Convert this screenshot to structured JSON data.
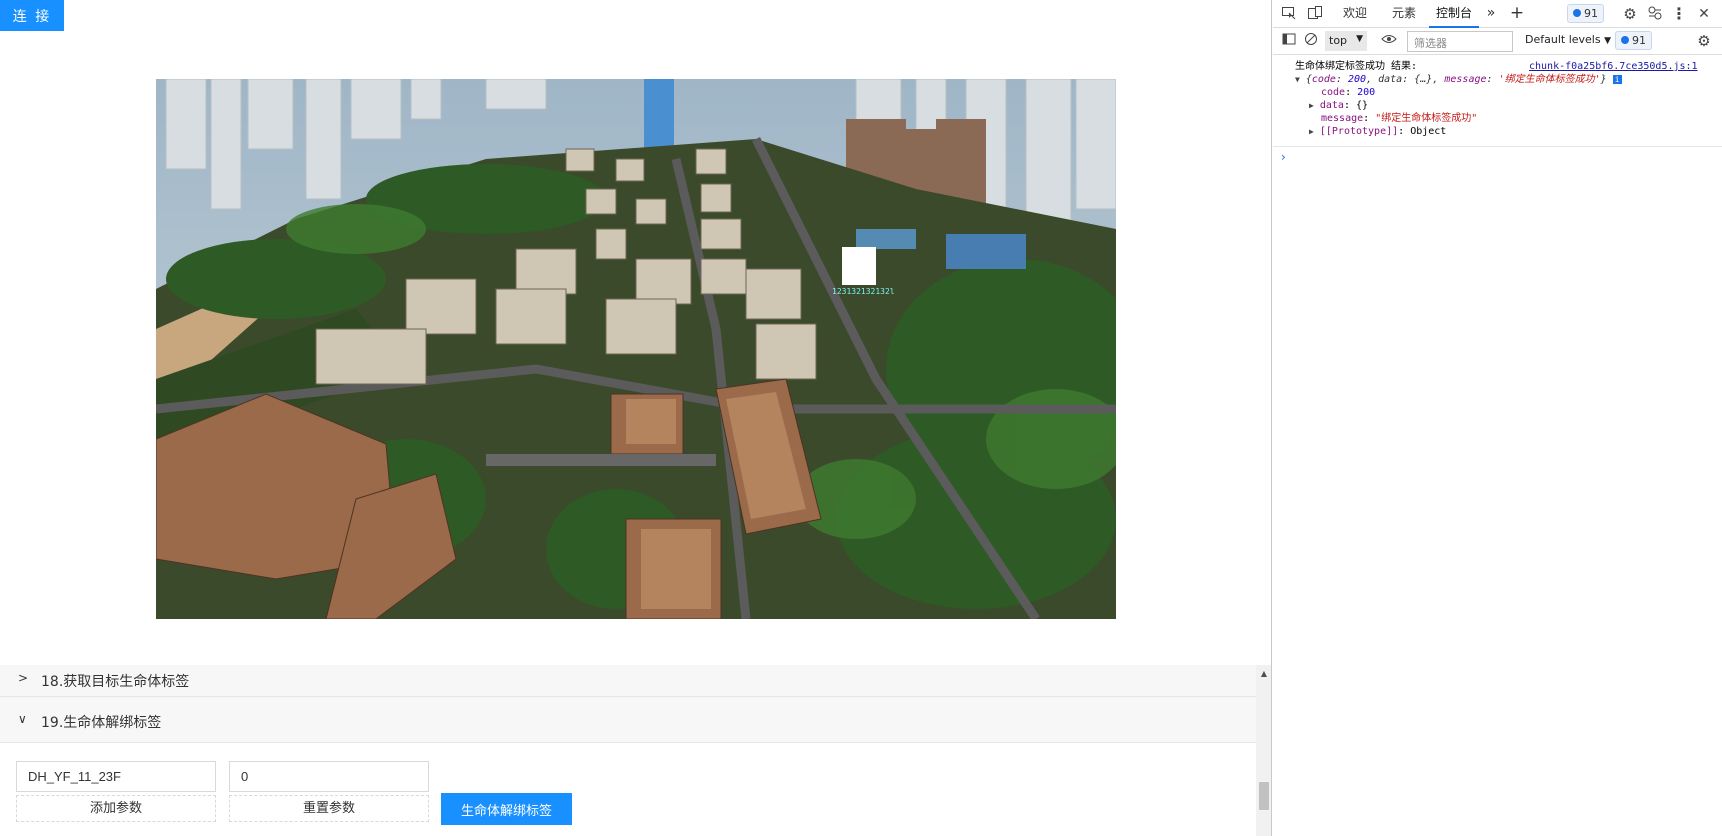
{
  "app": {
    "connect_label": "连 接",
    "scene_marker_label": "123132132132l"
  },
  "panel": {
    "section_18": {
      "title": "18.获取目标生命体标签",
      "arrow": ">"
    },
    "section_19": {
      "title": "19.生命体解绑标签",
      "arrow": "∨"
    },
    "input_1_value": "DH_YF_11_23F",
    "input_2_value": "0",
    "add_param_label": "添加参数",
    "reset_param_label": "重置参数",
    "unbind_label": "生命体解绑标签"
  },
  "devtools": {
    "tabs": [
      "欢迎",
      "元素",
      "控制台"
    ],
    "active_tab": "控制台",
    "more_tabs": "»",
    "add_tab": "+",
    "issues_count": "91",
    "close": "✕",
    "context": "top",
    "filter_placeholder": "筛选器",
    "levels_label": "Default levels",
    "toolbar_issues_count": "91",
    "console": {
      "log_prefix": "生命体绑定标签成功 结果:",
      "source_link": "chunk-f0a25bf6.7ce350d5.js:1",
      "summary_code_key": "code",
      "summary_code_val": "200",
      "summary_data": "data: {…}",
      "summary_message_key": "message",
      "summary_message_val": "'绑定生命体标签成功'",
      "code_key": "code",
      "code_val": "200",
      "data_key": "data",
      "data_val": "{}",
      "message_key": "message",
      "message_val": "\"绑定生命体标签成功\"",
      "proto_key": "[[Prototype]]",
      "proto_val": "Object",
      "prompt": "›"
    }
  },
  "colors": {
    "primary_blue": "#1890ff",
    "devtools_accent": "#1a73e8"
  }
}
